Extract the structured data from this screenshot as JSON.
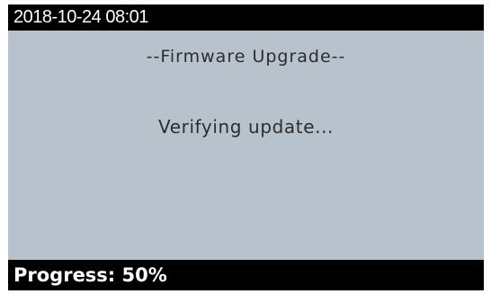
{
  "status_bar": {
    "datetime": "2018-10-24 08:01"
  },
  "content": {
    "title": "--Firmware Upgrade--",
    "message": "Verifying update..."
  },
  "footer": {
    "progress_label": "Progress: 50%",
    "progress_value": 50
  },
  "colors": {
    "screen_background": "#b7c2cd",
    "bar_background": "#000000",
    "bar_text": "#ffffff",
    "body_text": "#2b2d31"
  }
}
